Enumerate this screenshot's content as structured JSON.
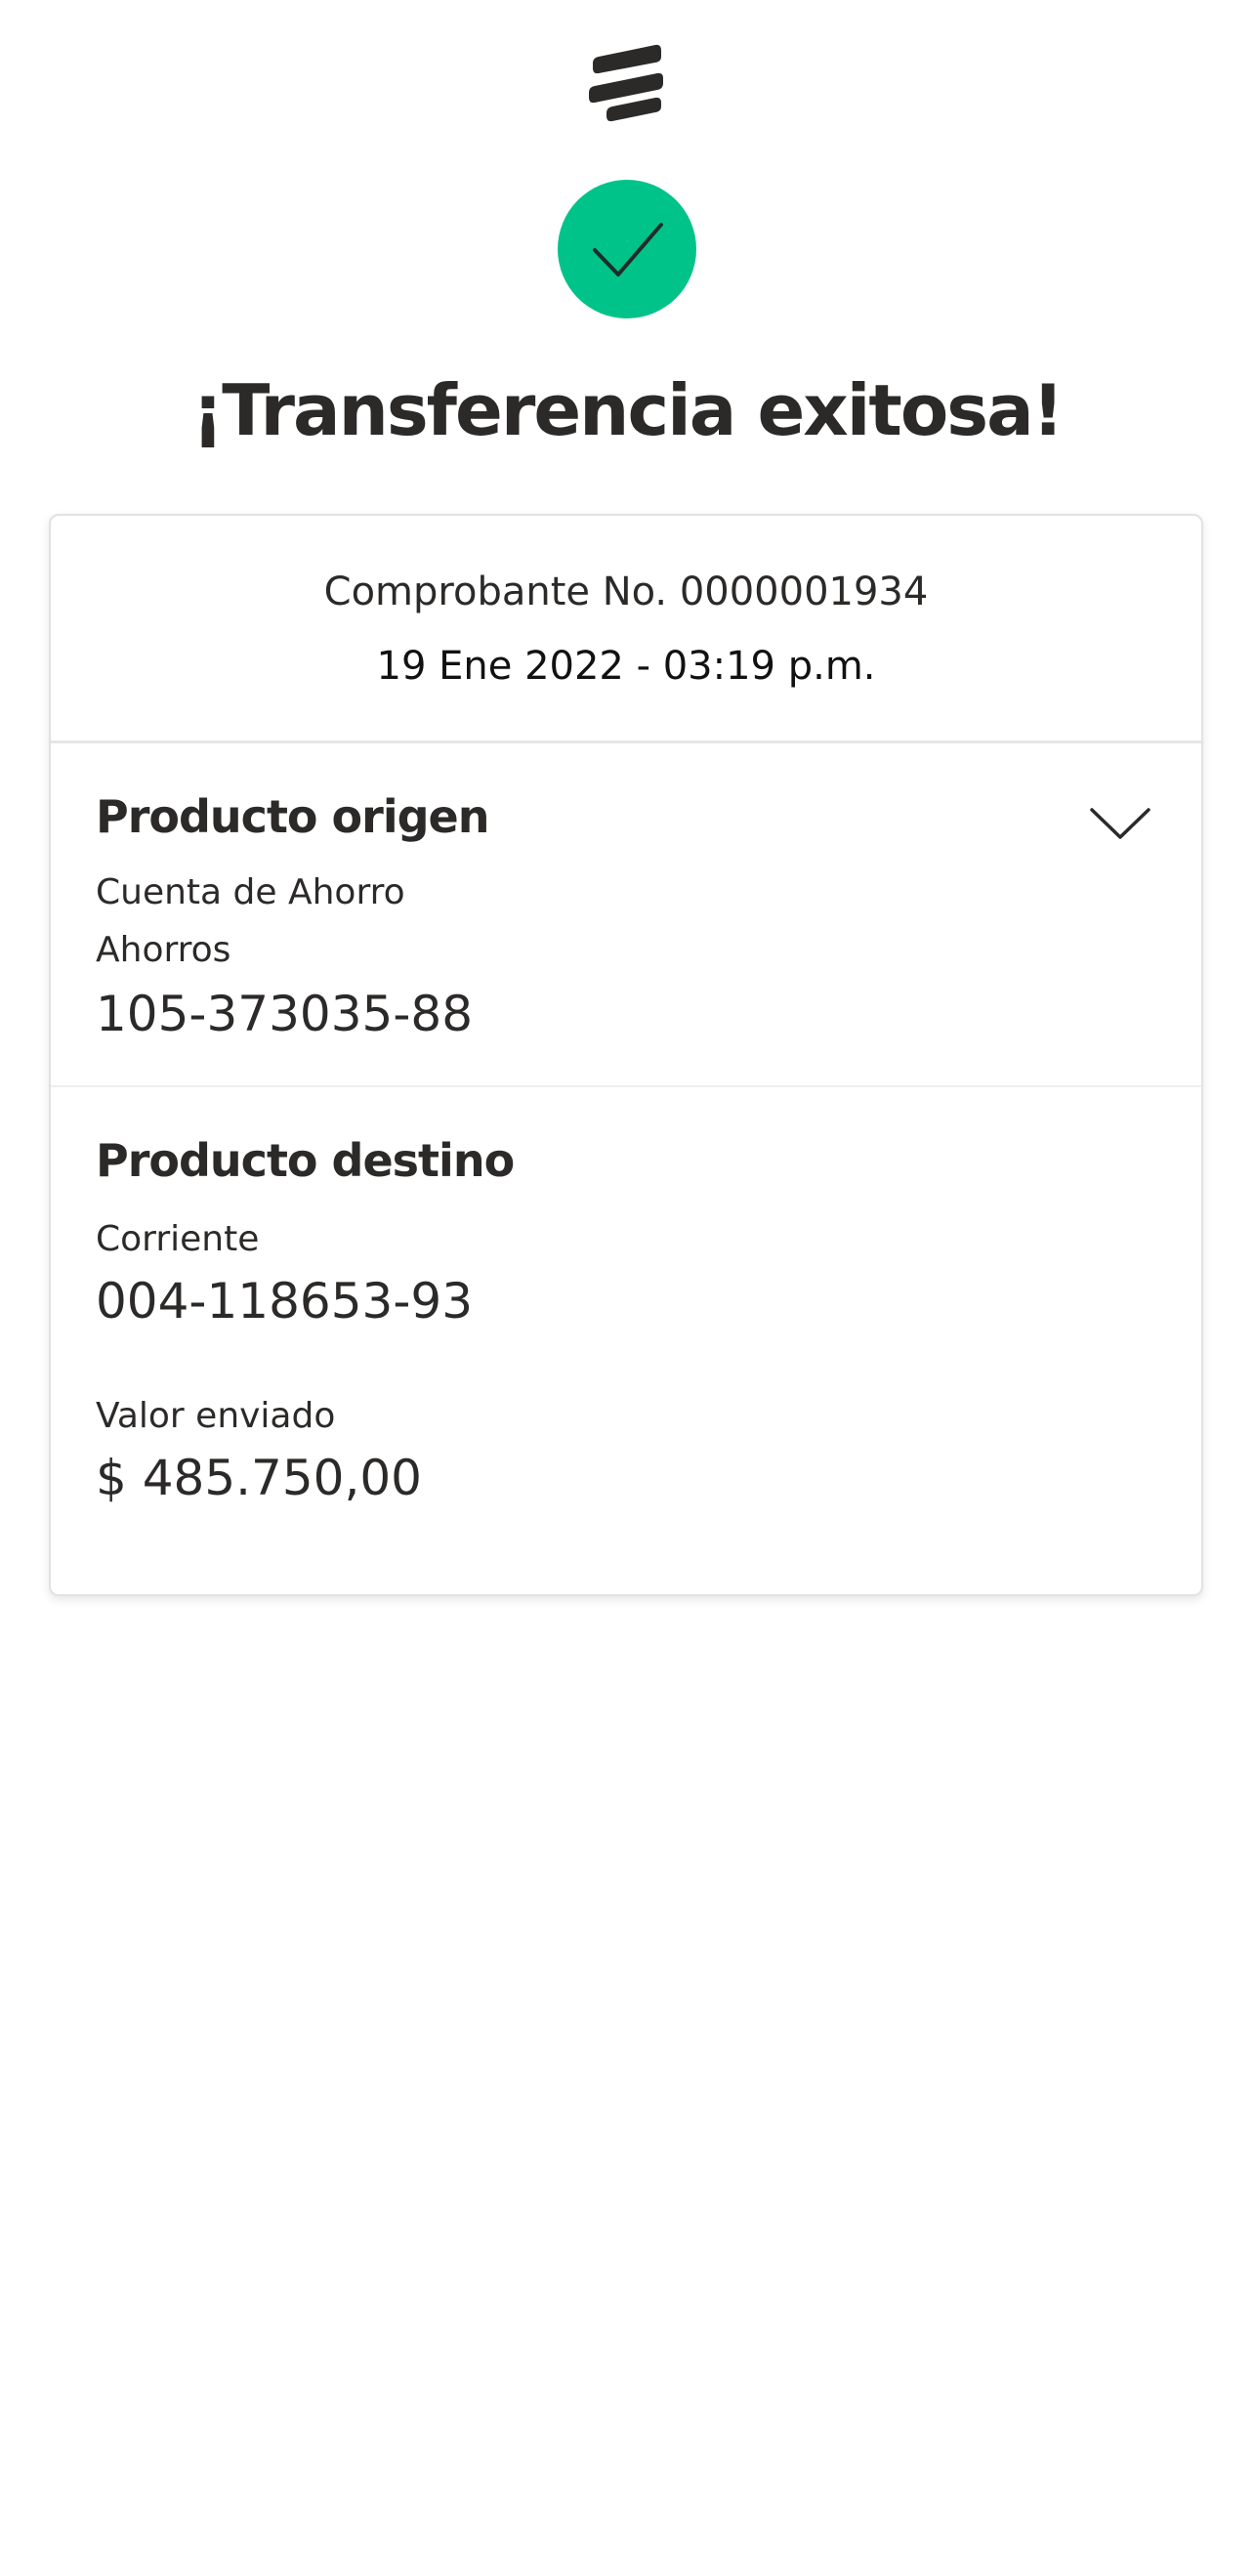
{
  "header": {
    "logo_icon": "bank-logo-icon",
    "status_icon": "check-icon",
    "status_color": "#00c389",
    "title": "¡Transferencia exitosa!"
  },
  "receipt": {
    "number": "Comprobante No. 0000001934",
    "datetime": "19 Ene 2022 - 03:19 p.m."
  },
  "origin": {
    "title": "Producto origen",
    "expand_icon": "chevron-down-icon",
    "account_type": "Cuenta de Ahorro",
    "account_subtype": "Ahorros",
    "account_number": "105-373035-88"
  },
  "destination": {
    "title": "Producto destino",
    "account_type": "Corriente",
    "account_number": "004-118653-93",
    "amount_label": "Valor enviado",
    "amount": "$ 485.750,00"
  }
}
